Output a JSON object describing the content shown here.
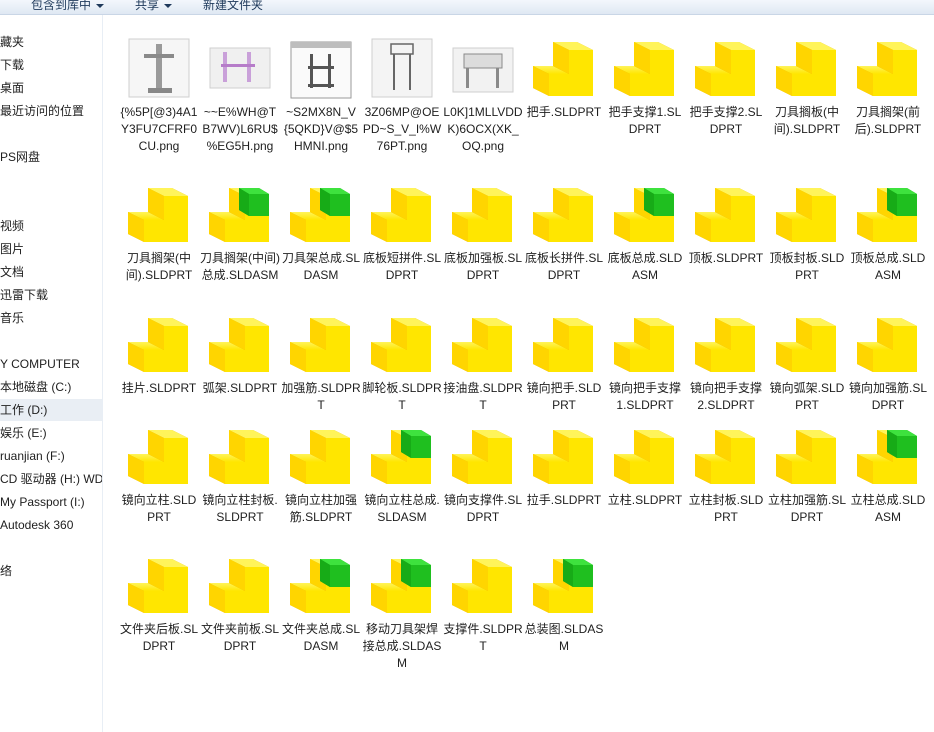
{
  "toolbar": {
    "include_label": "包含到库中",
    "share_label": "共享",
    "new_folder_label": "新建文件夹"
  },
  "sidebar": {
    "items": [
      {
        "label": "藏夹"
      },
      {
        "label": "下载"
      },
      {
        "label": "桌面"
      },
      {
        "label": "最近访问的位置"
      },
      {
        "label": "PS网盘"
      },
      {
        "label": "视频"
      },
      {
        "label": "图片"
      },
      {
        "label": "文档"
      },
      {
        "label": "迅雷下载"
      },
      {
        "label": "音乐"
      },
      {
        "label": "Y COMPUTER"
      },
      {
        "label": "本地磁盘 (C:)"
      },
      {
        "label": "工作 (D:)"
      },
      {
        "label": "娱乐 (E:)"
      },
      {
        "label": "ruanjian (F:)"
      },
      {
        "label": "CD 驱动器 (H:) WD"
      },
      {
        "label": "My Passport (I:)"
      },
      {
        "label": "Autodesk 360"
      },
      {
        "label": "络"
      }
    ]
  },
  "colors": {
    "part_yellow": "#ffe600",
    "part_dark": "#e0a800",
    "asm_green": "#1fbf1f",
    "selected_bg": "#e9eef4"
  },
  "files": [
    {
      "name": "{%5P[@3)4A1Y3FU7CFRF0CU.png",
      "type": "png",
      "variant": "a"
    },
    {
      "name": "~~E%WH@TB7WV)L6RU$%EG5H.png",
      "type": "png",
      "variant": "b"
    },
    {
      "name": "~S2MX8N_V{5QKD}V@$5HMNI.png",
      "type": "png",
      "variant": "c"
    },
    {
      "name": "3Z06MP@OEPD~S_V_I%W76PT.png",
      "type": "png",
      "variant": "d"
    },
    {
      "name": "L0K]1MLLVDDK)6OCX(XK_OQ.png",
      "type": "png",
      "variant": "e"
    },
    {
      "name": "把手.SLDPRT",
      "type": "part"
    },
    {
      "name": "把手支撑1.SLDPRT",
      "type": "part"
    },
    {
      "name": "把手支撑2.SLDPRT",
      "type": "part"
    },
    {
      "name": "刀具搁板(中间).SLDPRT",
      "type": "part"
    },
    {
      "name": "刀具搁架(前后).SLDPRT",
      "type": "part"
    },
    {
      "name": "刀具搁架(中间).SLDPRT",
      "type": "part"
    },
    {
      "name": "刀具搁架(中间)总成.SLDASM",
      "type": "asm"
    },
    {
      "name": "刀具架总成.SLDASM",
      "type": "asm"
    },
    {
      "name": "底板短拼件.SLDPRT",
      "type": "part"
    },
    {
      "name": "底板加强板.SLDPRT",
      "type": "part"
    },
    {
      "name": "底板长拼件.SLDPRT",
      "type": "part"
    },
    {
      "name": "底板总成.SLDASM",
      "type": "asm"
    },
    {
      "name": "顶板.SLDPRT",
      "type": "part"
    },
    {
      "name": "顶板封板.SLDPRT",
      "type": "part"
    },
    {
      "name": "顶板总成.SLDASM",
      "type": "asm"
    },
    {
      "name": "挂片.SLDPRT",
      "type": "part"
    },
    {
      "name": "弧架.SLDPRT",
      "type": "part"
    },
    {
      "name": "加强筋.SLDPRT",
      "type": "part"
    },
    {
      "name": "脚轮板.SLDPRT",
      "type": "part"
    },
    {
      "name": "接油盘.SLDPRT",
      "type": "part"
    },
    {
      "name": "镜向把手.SLDPRT",
      "type": "part"
    },
    {
      "name": "镜向把手支撑1.SLDPRT",
      "type": "part"
    },
    {
      "name": "镜向把手支撑2.SLDPRT",
      "type": "part"
    },
    {
      "name": "镜向弧架.SLDPRT",
      "type": "part"
    },
    {
      "name": "镜向加强筋.SLDPRT",
      "type": "part"
    },
    {
      "name": "镜向立柱.SLDPRT",
      "type": "part"
    },
    {
      "name": "镜向立柱封板.SLDPRT",
      "type": "part"
    },
    {
      "name": "镜向立柱加强筋.SLDPRT",
      "type": "part"
    },
    {
      "name": "镜向立柱总成.SLDASM",
      "type": "asm"
    },
    {
      "name": "镜向支撑件.SLDPRT",
      "type": "part"
    },
    {
      "name": "拉手.SLDPRT",
      "type": "part"
    },
    {
      "name": "立柱.SLDPRT",
      "type": "part"
    },
    {
      "name": "立柱封板.SLDPRT",
      "type": "part"
    },
    {
      "name": "立柱加强筋.SLDPRT",
      "type": "part"
    },
    {
      "name": "立柱总成.SLDASM",
      "type": "asm"
    },
    {
      "name": "文件夹后板.SLDPRT",
      "type": "part"
    },
    {
      "name": "文件夹前板.SLDPRT",
      "type": "part"
    },
    {
      "name": "文件夹总成.SLDASM",
      "type": "asm"
    },
    {
      "name": "移动刀具架焊接总成.SLDASM",
      "type": "asm"
    },
    {
      "name": "支撑件.SLDPRT",
      "type": "part"
    },
    {
      "name": "总装图.SLDASM",
      "type": "asm"
    }
  ]
}
